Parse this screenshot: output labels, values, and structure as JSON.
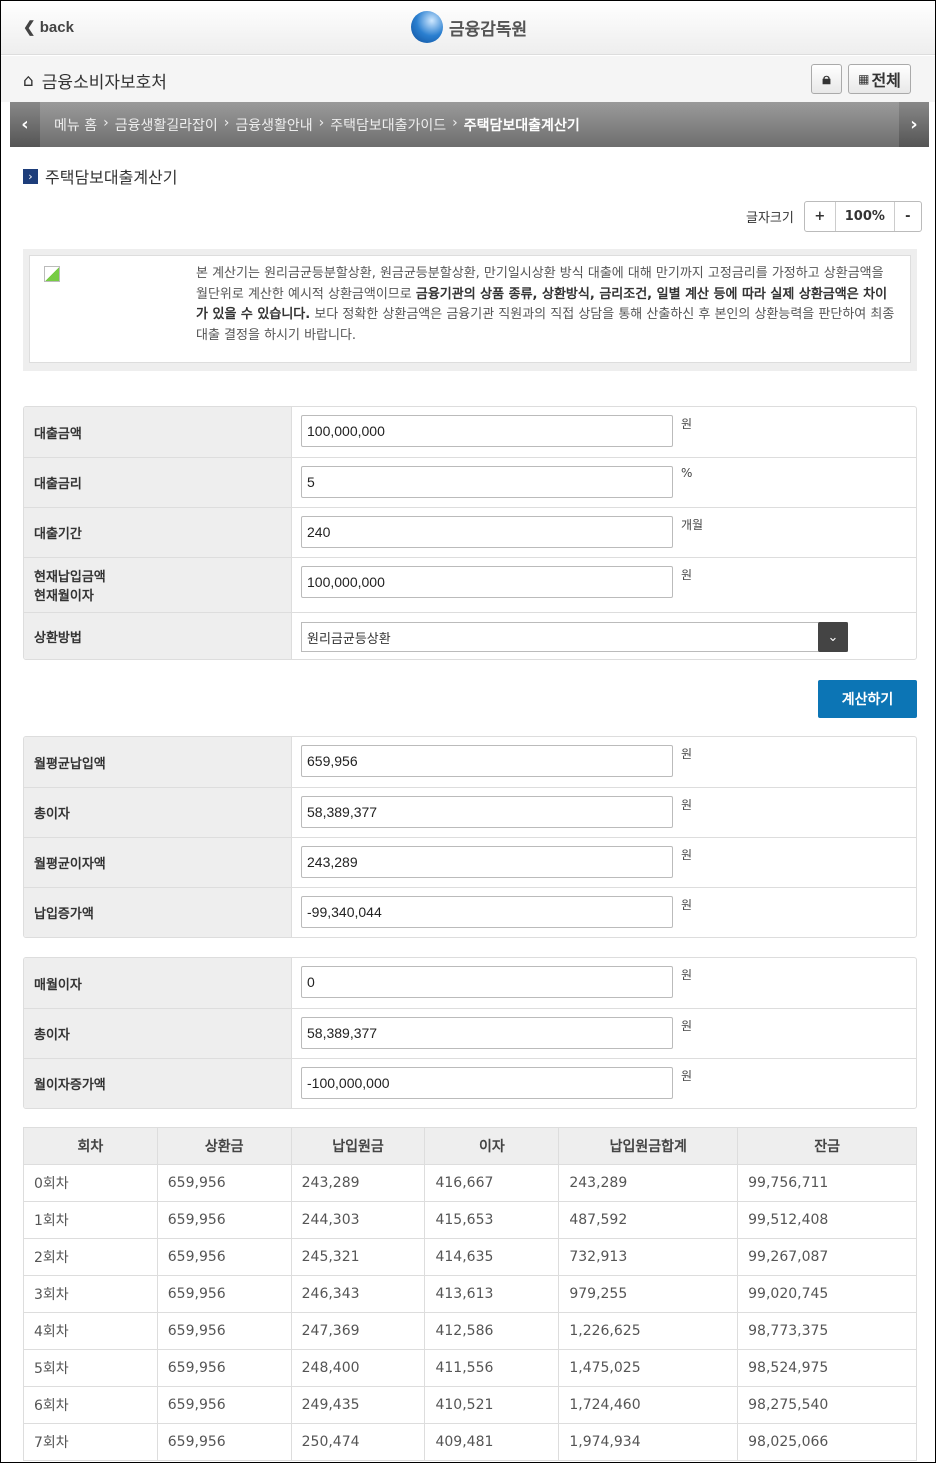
{
  "header": {
    "back_label": "back",
    "logo_text": "금융감독원"
  },
  "subheader": {
    "title": "금융소비자보호처",
    "all_label": "전체"
  },
  "breadcrumb": {
    "items": [
      "메뉴 홈",
      "금융생활길라잡이",
      "금융생활안내",
      "주택담보대출가이드"
    ],
    "current": "주택담보대출계산기"
  },
  "page_title": "주택담보대출계산기",
  "font_size": {
    "label": "글자크기",
    "plus": "+",
    "value": "100%",
    "minus": "-"
  },
  "notice": {
    "part1": "본 계산기는 원리금균등분할상환, 원금균등분할상환, 만기일시상환 방식 대출에 대해 만기까지 고정금리를 가정하고 상환금액을 월단위로 계산한 예시적 상환금액이므로 ",
    "bold": "금융기관의 상품 종류, 상환방식, 금리조건, 일별 계산 등에 따라 실제 상환금액은 차이가 있을 수 있습니다.",
    "part2": " 보다 정확한 상환금액은 금융기관 직원과의 직접 상담을 통해 산출하신 후 본인의 상환능력을 판단하여 최종 대출 결정을 하시기 바랍니다."
  },
  "inputs": [
    {
      "label": "대출금액",
      "value": "100,000,000",
      "unit": "원"
    },
    {
      "label": "대출금리",
      "value": "5",
      "unit": "%"
    },
    {
      "label": "대출기간",
      "value": "240",
      "unit": "개월"
    },
    {
      "label": "현재납입금액",
      "label2": "현재월이자",
      "value": "100,000,000",
      "unit": "원"
    }
  ],
  "method": {
    "label": "상환방법",
    "value": "원리금균등상환"
  },
  "calc_label": "계산하기",
  "results1": [
    {
      "label": "월평균납입액",
      "value": "659,956",
      "unit": "원"
    },
    {
      "label": "총이자",
      "value": "58,389,377",
      "unit": "원"
    },
    {
      "label": "월평균이자액",
      "value": "243,289",
      "unit": "원"
    },
    {
      "label": "납입증가액",
      "value": "-99,340,044",
      "unit": "원"
    }
  ],
  "results2": [
    {
      "label": "매월이자",
      "value": "0",
      "unit": "원"
    },
    {
      "label": "총이자",
      "value": "58,389,377",
      "unit": "원"
    },
    {
      "label": "월이자증가액",
      "value": "-100,000,000",
      "unit": "원"
    }
  ],
  "schedule": {
    "headers": [
      "회차",
      "상환금",
      "납입원금",
      "이자",
      "납입원금합계",
      "잔금"
    ],
    "rows": [
      [
        "0회차",
        "659,956",
        "243,289",
        "416,667",
        "243,289",
        "99,756,711"
      ],
      [
        "1회차",
        "659,956",
        "244,303",
        "415,653",
        "487,592",
        "99,512,408"
      ],
      [
        "2회차",
        "659,956",
        "245,321",
        "414,635",
        "732,913",
        "99,267,087"
      ],
      [
        "3회차",
        "659,956",
        "246,343",
        "413,613",
        "979,255",
        "99,020,745"
      ],
      [
        "4회차",
        "659,956",
        "247,369",
        "412,586",
        "1,226,625",
        "98,773,375"
      ],
      [
        "5회차",
        "659,956",
        "248,400",
        "411,556",
        "1,475,025",
        "98,524,975"
      ],
      [
        "6회차",
        "659,956",
        "249,435",
        "410,521",
        "1,724,460",
        "98,275,540"
      ],
      [
        "7회차",
        "659,956",
        "250,474",
        "409,481",
        "1,974,934",
        "98,025,066"
      ]
    ]
  }
}
